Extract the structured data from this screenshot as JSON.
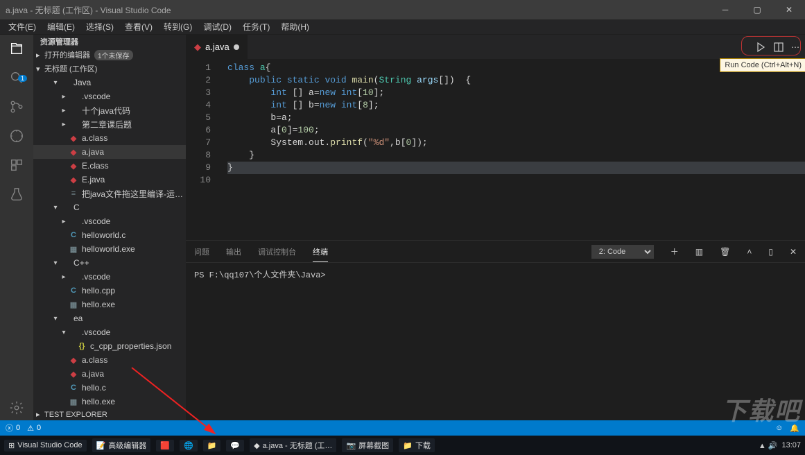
{
  "window": {
    "title": "a.java - 无标题 (工作区) - Visual Studio Code"
  },
  "menu": {
    "items": [
      "文件(E)",
      "编辑(E)",
      "选择(S)",
      "查看(V)",
      "转到(G)",
      "调试(D)",
      "任务(T)",
      "帮助(H)"
    ]
  },
  "activity": {
    "badge": "1"
  },
  "sidebar": {
    "title": "资源管理器",
    "openEditorsLabel": "打开的编辑器",
    "openEditorsBadge": "1个未保存",
    "workspaceLabel": "无标题 (工作区)",
    "tree": [
      {
        "t": "fold",
        "l": "Java",
        "open": true,
        "d": 1
      },
      {
        "t": "fold",
        "l": ".vscode",
        "d": 2
      },
      {
        "t": "fold",
        "l": "十个java代码",
        "d": 2
      },
      {
        "t": "fold",
        "l": "第二章课后题",
        "d": 2
      },
      {
        "t": "java",
        "l": "a.class",
        "d": 2
      },
      {
        "t": "java",
        "l": "a.java",
        "d": 2,
        "sel": true
      },
      {
        "t": "java",
        "l": "E.class",
        "d": 2
      },
      {
        "t": "java",
        "l": "E.java",
        "d": 2
      },
      {
        "t": "txt",
        "l": "把java文件拖这里编译-运…",
        "d": 2
      },
      {
        "t": "fold",
        "l": "C",
        "open": true,
        "d": 1
      },
      {
        "t": "fold",
        "l": ".vscode",
        "d": 2
      },
      {
        "t": "c",
        "l": "helloworld.c",
        "d": 2
      },
      {
        "t": "exe",
        "l": "helloworld.exe",
        "d": 2
      },
      {
        "t": "fold",
        "l": "C++",
        "open": true,
        "d": 1
      },
      {
        "t": "fold",
        "l": ".vscode",
        "d": 2
      },
      {
        "t": "cpp",
        "l": "hello.cpp",
        "d": 2
      },
      {
        "t": "exe",
        "l": "hello.exe",
        "d": 2
      },
      {
        "t": "fold",
        "l": "ea",
        "open": true,
        "d": 1
      },
      {
        "t": "fold",
        "l": ".vscode",
        "open": true,
        "d": 2
      },
      {
        "t": "json",
        "l": "c_cpp_properties.json",
        "d": 3
      },
      {
        "t": "java",
        "l": "a.class",
        "d": 2
      },
      {
        "t": "java",
        "l": "a.java",
        "d": 2
      },
      {
        "t": "c",
        "l": "hello.c",
        "d": 2
      },
      {
        "t": "exe",
        "l": "hello.exe",
        "d": 2
      }
    ],
    "testExplorer": "TEST EXPLORER"
  },
  "editor": {
    "tabName": "a.java",
    "tooltip": "Run Code (Ctrl+Alt+N)",
    "lines": [
      "1",
      "2",
      "3",
      "4",
      "5",
      "6",
      "7",
      "8",
      "9",
      "10"
    ]
  },
  "code": {
    "l1a": "class ",
    "l1b": "a",
    "l1c": "{",
    "l2a": "public ",
    "l2b": "static ",
    "l2c": "void ",
    "l2d": "main",
    "l2e": "(",
    "l2f": "String ",
    "l2g": "args",
    "l2h": "[])  {",
    "l3a": "int ",
    "l3b": "[] a=",
    "l3c": "new ",
    "l3d": "int",
    "l3e": "[",
    "l3f": "10",
    "l3g": "];",
    "l4a": "int ",
    "l4b": "[] b=",
    "l4c": "new ",
    "l4d": "int",
    "l4e": "[",
    "l4f": "8",
    "l4g": "];",
    "l5": "b=a;",
    "l6a": "a[",
    "l6b": "0",
    "l6c": "]=",
    "l6d": "100",
    "l6e": ";",
    "l7a": "System.out.",
    "l7b": "printf",
    "l7c": "(",
    "l7d": "\"%d\"",
    "l7e": ",b[",
    "l7f": "0",
    "l7g": "]);",
    "l8": "}",
    "l9": "}"
  },
  "panel": {
    "tabs": {
      "problems": "问题",
      "output": "输出",
      "debug": "调试控制台",
      "terminal": "终端"
    },
    "dropdown": "2: Code",
    "prompt": "PS F:\\qq107\\个人文件夹\\Java>"
  },
  "status": {
    "errors": "0",
    "warnings": "0"
  },
  "taskbar": {
    "items": [
      "Visual Studio Code",
      "高级编辑器",
      "a.java - 无标题 (工…",
      "屏幕截图",
      "下载"
    ],
    "time": "13:07"
  },
  "watermark": "下载吧"
}
